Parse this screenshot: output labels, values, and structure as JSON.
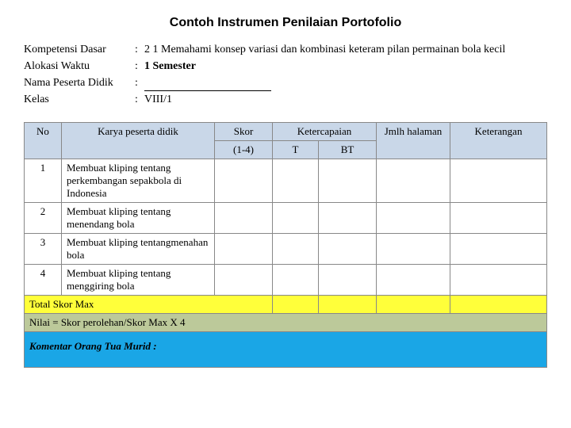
{
  "title": "Contoh Instrumen Penilaian Portofolio",
  "meta": {
    "kompetensi_label": "Kompetensi Dasar",
    "kompetensi_value": "2 1 Memahami konsep variasi dan kombinasi keteram pilan permainan bola kecil",
    "alokasi_label": "Alokasi Waktu",
    "alokasi_value": "1 Semester",
    "nama_label": "Nama Peserta Didik",
    "nama_value": "",
    "kelas_label": "Kelas",
    "kelas_value": "VIII/1"
  },
  "headers": {
    "no": "No",
    "karya": "Karya peserta didik",
    "skor": "Skor",
    "skor_sub": "(1-4)",
    "ketercapaian": "Ketercapaian",
    "t": "T",
    "bt": "BT",
    "jmlh": "Jmlh halaman",
    "keterangan": "Keterangan"
  },
  "rows": [
    {
      "no": "1",
      "karya": "Membuat kliping tentang perkembangan sepakbola di Indonesia"
    },
    {
      "no": "2",
      "karya": "Membuat kliping tentang menendang bola"
    },
    {
      "no": "3",
      "karya": "Membuat kliping tentangmenahan bola"
    },
    {
      "no": "4",
      "karya": "Membuat kliping tentang menggiring bola"
    }
  ],
  "footer": {
    "total": "Total Skor Max",
    "nilai": "Nilai = Skor perolehan/Skor Max X 4",
    "komentar": "Komentar Orang Tua Murid :"
  }
}
